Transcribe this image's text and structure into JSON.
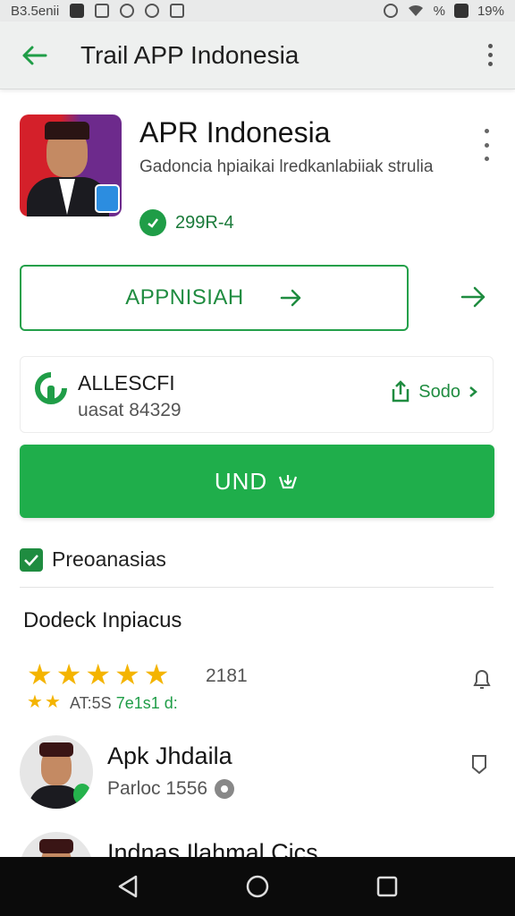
{
  "status_bar": {
    "left_text": "B3.5enii",
    "battery_percent": "19%",
    "signal_text": "%"
  },
  "app_bar": {
    "title": "Trail APP Indonesia"
  },
  "app_header": {
    "name": "APR Indonesia",
    "subtitle": "Gadoncia hpiaikai lredkanlabiiak strulia",
    "rating_text": "299R-4"
  },
  "outline_button": {
    "label": "APPNISIAH"
  },
  "alert_card": {
    "title": "ALLESCFI",
    "subtitle": "uasat 84329",
    "action_label": "Sodo"
  },
  "primary_button": {
    "label": "UND"
  },
  "checkbox": {
    "label": "Preoanasias",
    "checked": true
  },
  "reviews_section": {
    "title": "Dodeck Inpiacus",
    "stars": 5,
    "count": "2181",
    "mini_label_prefix": "AT:5S ",
    "mini_label_green": "7e1s1 d:"
  },
  "review_items": [
    {
      "name": "Apk Jhdaila",
      "meta": "Parloc 1556"
    },
    {
      "name": "Indnas Ilahmal Cics",
      "meta": ""
    }
  ],
  "colors": {
    "accent": "#1fae4b",
    "accent_dark": "#1f8c40",
    "star": "#f4b400",
    "nav_bar": "#0b0b0b"
  }
}
